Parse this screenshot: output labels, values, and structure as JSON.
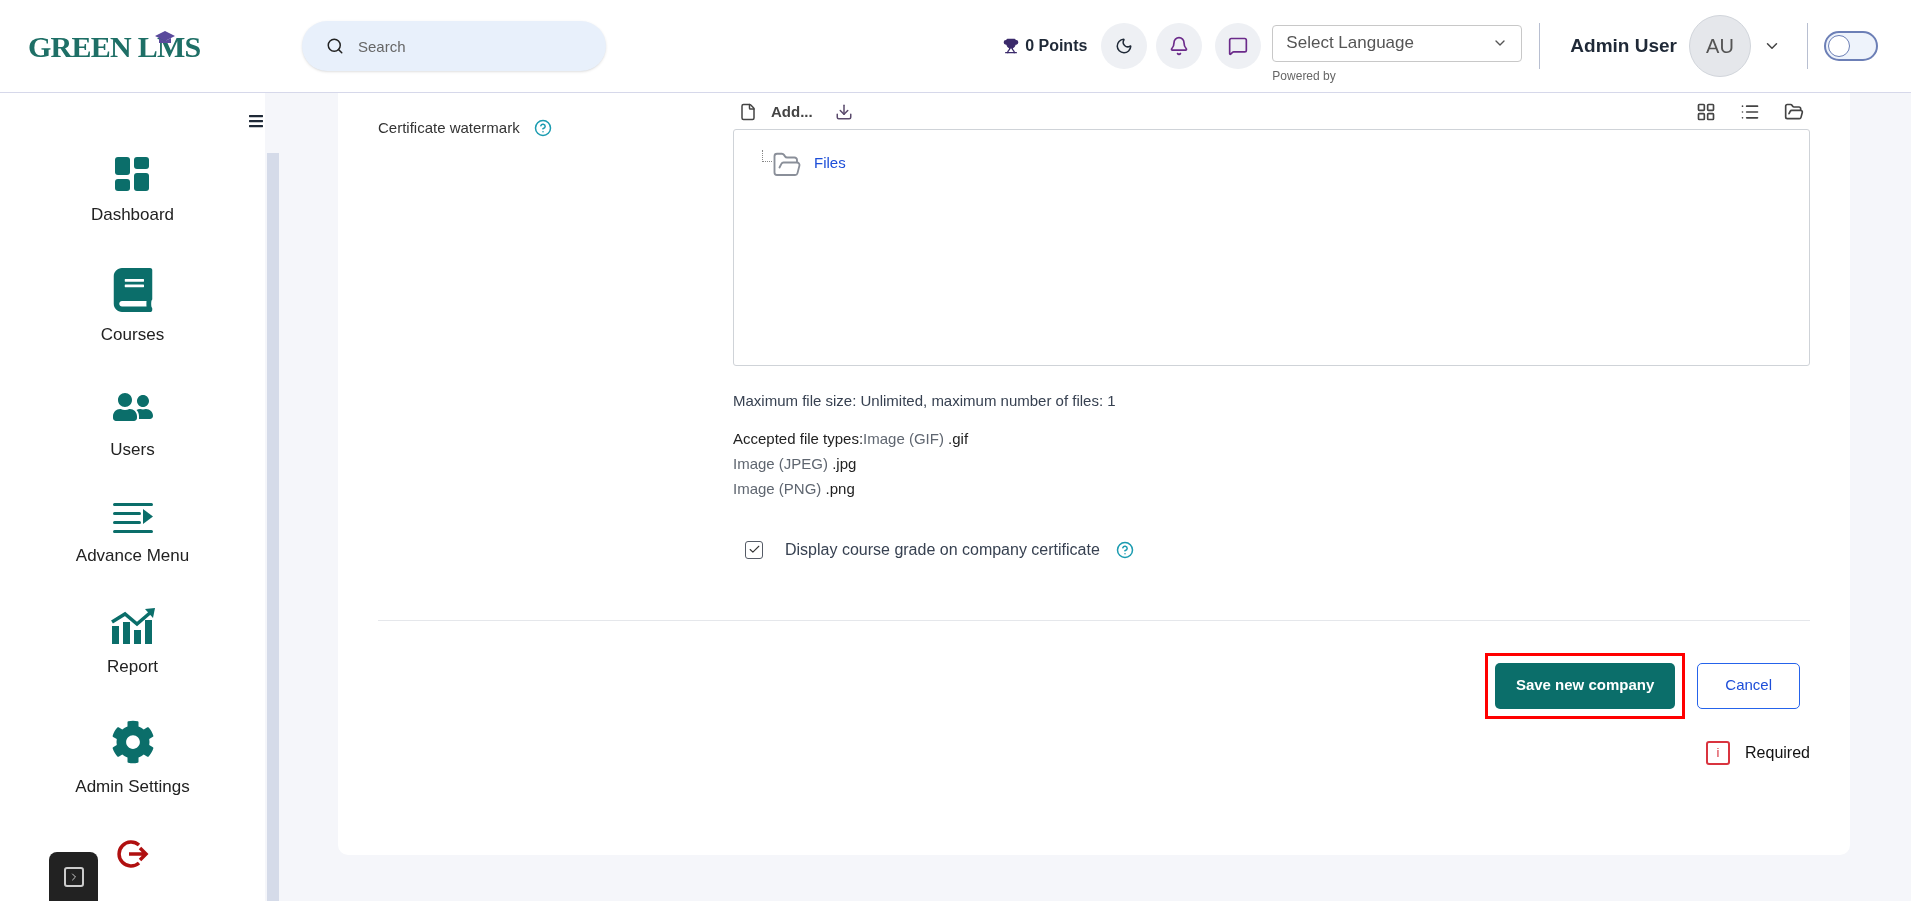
{
  "header": {
    "logo": "GREEN LMS",
    "search": {
      "placeholder": "Search"
    },
    "points": "0 Points",
    "language_select": {
      "value": "Select Language"
    },
    "powered_by": "Powered by",
    "user_name": "Admin User",
    "avatar_initials": "AU",
    "theme_toggle": {
      "on": false
    }
  },
  "sidebar": {
    "items": [
      {
        "kind": "dashboard",
        "label": "Dashboard"
      },
      {
        "kind": "courses",
        "label": "Courses"
      },
      {
        "kind": "users",
        "label": "Users"
      },
      {
        "kind": "menu",
        "label": "Advance Menu"
      },
      {
        "kind": "report",
        "label": "Report"
      },
      {
        "kind": "settings",
        "label": "Admin Settings"
      },
      {
        "kind": "logout"
      }
    ]
  },
  "form": {
    "field_label": "Certificate watermark",
    "file_manager": {
      "add_label": "Add...",
      "folder": "Files"
    },
    "max_size": "Maximum file size: Unlimited, maximum number of files: 1",
    "accepted_label": "Accepted file types:",
    "file_types": [
      {
        "name": "Image (GIF)",
        "ext": ".gif"
      },
      {
        "name": "Image (JPEG)",
        "ext": ".jpg"
      },
      {
        "name": "Image (PNG)",
        "ext": ".png"
      }
    ],
    "checkbox": {
      "label": "Display course grade on company certificate",
      "checked": true
    },
    "buttons": [
      {
        "label": "Save new company",
        "kind": "primary",
        "highlighted": true
      },
      {
        "label": "Cancel",
        "kind": "secondary",
        "highlighted": false
      }
    ],
    "required_icon": "i",
    "required_note": "Required"
  }
}
